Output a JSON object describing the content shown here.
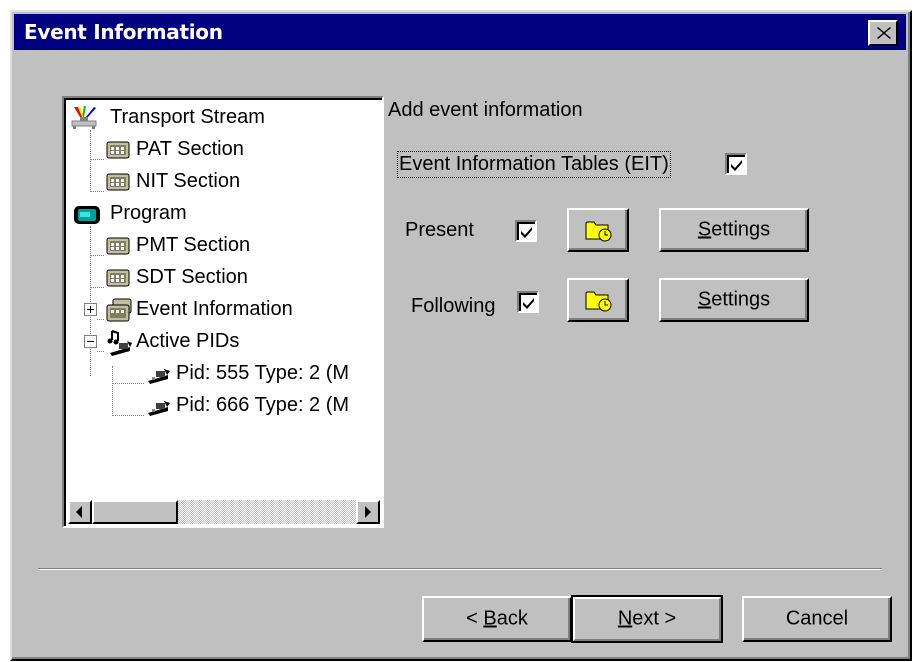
{
  "window": {
    "title": "Event Information",
    "close_glyph": "✕"
  },
  "tree": {
    "items": [
      {
        "label": "Transport Stream",
        "icon": "transport-stream-icon"
      },
      {
        "label": "PAT Section",
        "icon": "section-icon"
      },
      {
        "label": "NIT Section",
        "icon": "section-icon"
      },
      {
        "label": "Program",
        "icon": "program-icon"
      },
      {
        "label": "PMT Section",
        "icon": "section-icon"
      },
      {
        "label": "SDT Section",
        "icon": "section-icon"
      },
      {
        "label": "Event Information",
        "icon": "event-table-icon",
        "expander": "+"
      },
      {
        "label": "Active PIDs",
        "icon": "active-pids-icon",
        "expander": "-"
      },
      {
        "label": "Pid: 555 Type: 2 (M",
        "icon": "pid-icon"
      },
      {
        "label": "Pid: 666 Type: 2 (M",
        "icon": "pid-icon"
      }
    ]
  },
  "panel": {
    "heading": "Add event information",
    "eit_label": "Event Information Tables (EIT)",
    "eit_checked": true,
    "present": {
      "label": "Present",
      "checked": true,
      "settings_prefix": "",
      "settings_mnemonic": "S",
      "settings_rest": "ettings"
    },
    "following": {
      "label": "Following",
      "checked": true,
      "settings_prefix": "",
      "settings_mnemonic": "S",
      "settings_rest": "ettings"
    }
  },
  "footer": {
    "back_prefix": "< ",
    "back_mnemonic": "B",
    "back_rest": "ack",
    "next_mnemonic": "N",
    "next_rest": "ext >",
    "cancel_label": "Cancel"
  },
  "colors": {
    "titlebar": "#000080",
    "face": "#c0c0c0",
    "folder": "#ffff00"
  }
}
